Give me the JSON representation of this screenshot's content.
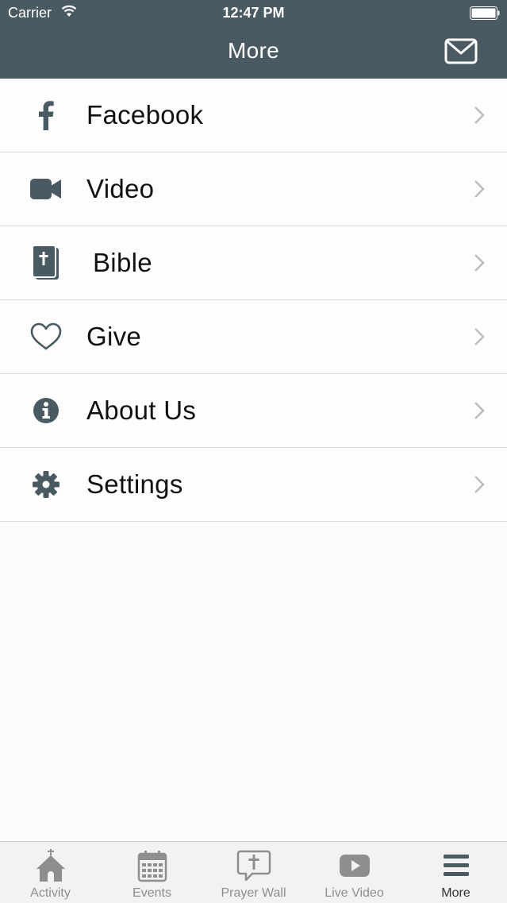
{
  "status_bar": {
    "carrier": "Carrier",
    "time": "12:47 PM"
  },
  "nav": {
    "title": "More",
    "action_icon": "mail-icon"
  },
  "menu": [
    {
      "label": "Facebook",
      "icon": "facebook-icon"
    },
    {
      "label": "Video",
      "icon": "video-camera-icon"
    },
    {
      "label": "Bible",
      "icon": "bible-icon"
    },
    {
      "label": "Give",
      "icon": "heart-icon"
    },
    {
      "label": "About Us",
      "icon": "info-icon"
    },
    {
      "label": "Settings",
      "icon": "gear-icon"
    }
  ],
  "tabs": [
    {
      "label": "Activity",
      "icon": "church-icon"
    },
    {
      "label": "Events",
      "icon": "calendar-icon"
    },
    {
      "label": "Prayer Wall",
      "icon": "prayer-bubble-icon"
    },
    {
      "label": "Live Video",
      "icon": "play-icon"
    },
    {
      "label": "More",
      "icon": "menu-icon",
      "active": true
    }
  ],
  "colors": {
    "header": "#4a5a63",
    "icon": "#4a5a63",
    "tab_icon": "#8e8e8e",
    "tab_active": "#4a5a63"
  }
}
